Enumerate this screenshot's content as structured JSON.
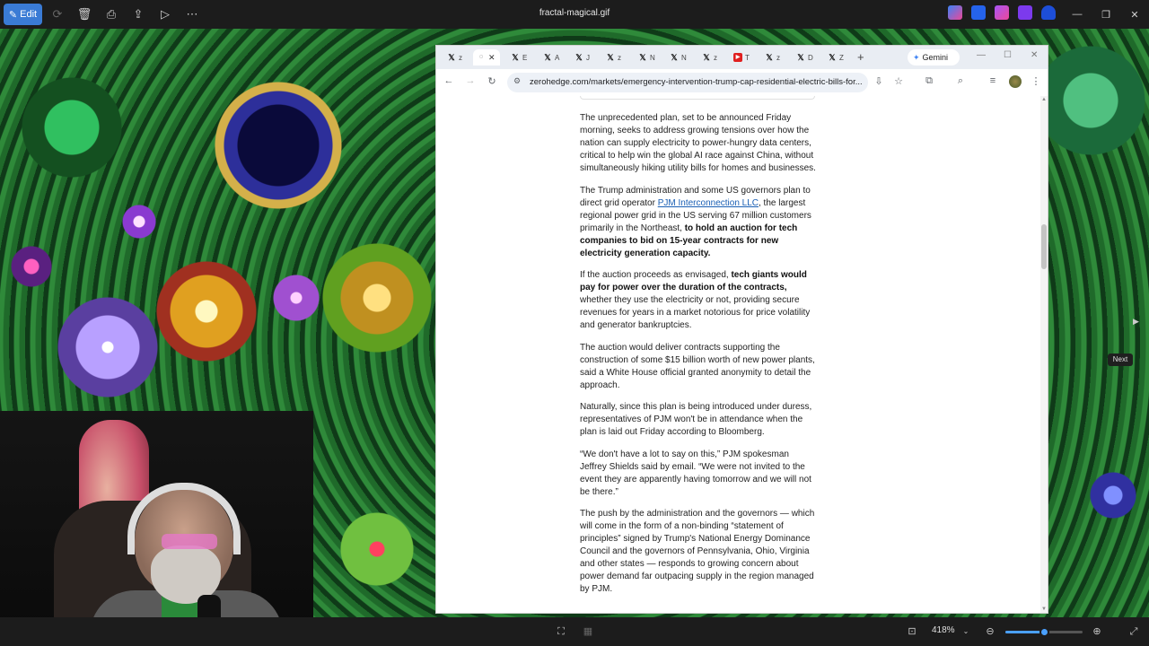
{
  "viewer": {
    "title": "fractal-magical.gif",
    "edit_label": "Edit",
    "zoom": "418%",
    "zoom_level_fraction": 0.5,
    "next_label": "Next",
    "accent_color": "#3a7bd5"
  },
  "browser": {
    "tabs": [
      {
        "icon": "x-icon",
        "label": "z"
      },
      {
        "icon": "loading-icon",
        "label": "",
        "active": true
      },
      {
        "icon": "x-icon",
        "label": "E"
      },
      {
        "icon": "x-icon",
        "label": "A"
      },
      {
        "icon": "x-icon",
        "label": "J"
      },
      {
        "icon": "x-icon",
        "label": "z"
      },
      {
        "icon": "x-icon",
        "label": "N"
      },
      {
        "icon": "x-icon",
        "label": "N"
      },
      {
        "icon": "x-icon",
        "label": "z"
      },
      {
        "icon": "youtube-icon",
        "label": "T"
      },
      {
        "icon": "x-icon",
        "label": "z"
      },
      {
        "icon": "x-icon",
        "label": "D"
      },
      {
        "icon": "x-icon",
        "label": "Z"
      }
    ],
    "gemini_label": "Gemini",
    "url": "zerohedge.com/markets/emergency-intervention-trump-cap-residential-electric-bills-for..."
  },
  "article": {
    "p1": "The unprecedented plan, set to be announced Friday morning, seeks to address growing tensions over how the nation can supply electricity to power-hungry data centers, critical to help win the global AI race against China, without simultaneously hiking utility bills for homes and businesses.",
    "p2_a": "The Trump administration and some US governors plan to direct grid operator ",
    "p2_link": "PJM Interconnection LLC",
    "p2_b": ", the largest regional power grid in the US serving 67 million customers primarily in the Northeast, ",
    "p2_bold": "to hold an auction for tech companies to bid on 15-year contracts for new electricity generation capacity.",
    "p3_a": "If the auction proceeds as envisaged, ",
    "p3_bold": "tech giants would pay for power over the duration of the contracts,",
    "p3_b": " whether they use the electricity or not, providing secure revenues for years in a market notorious for price volatility and generator bankruptcies.",
    "p4": "The auction would deliver contracts supporting the construction of some $15 billion worth of new power plants, said a White House official granted anonymity to detail the approach.",
    "p5": "Naturally, since this plan is being introduced under duress, representatives of PJM won't be in attendance when the plan is laid out Friday according to Bloomberg.",
    "p6": "“We don't have a lot to say on this,” PJM spokesman Jeffrey Shields said by email. “We were not invited to the event they are apparently having tomorrow and we will not be there.”",
    "p7": "The push by the administration and the governors — which will come in the form of a non-binding “statement of principles” signed by Trump's National Energy Dominance Council and the governors of Pennsylvania, Ohio, Virginia and other states — responds to growing concern about power demand far outpacing supply in the region managed by PJM."
  }
}
